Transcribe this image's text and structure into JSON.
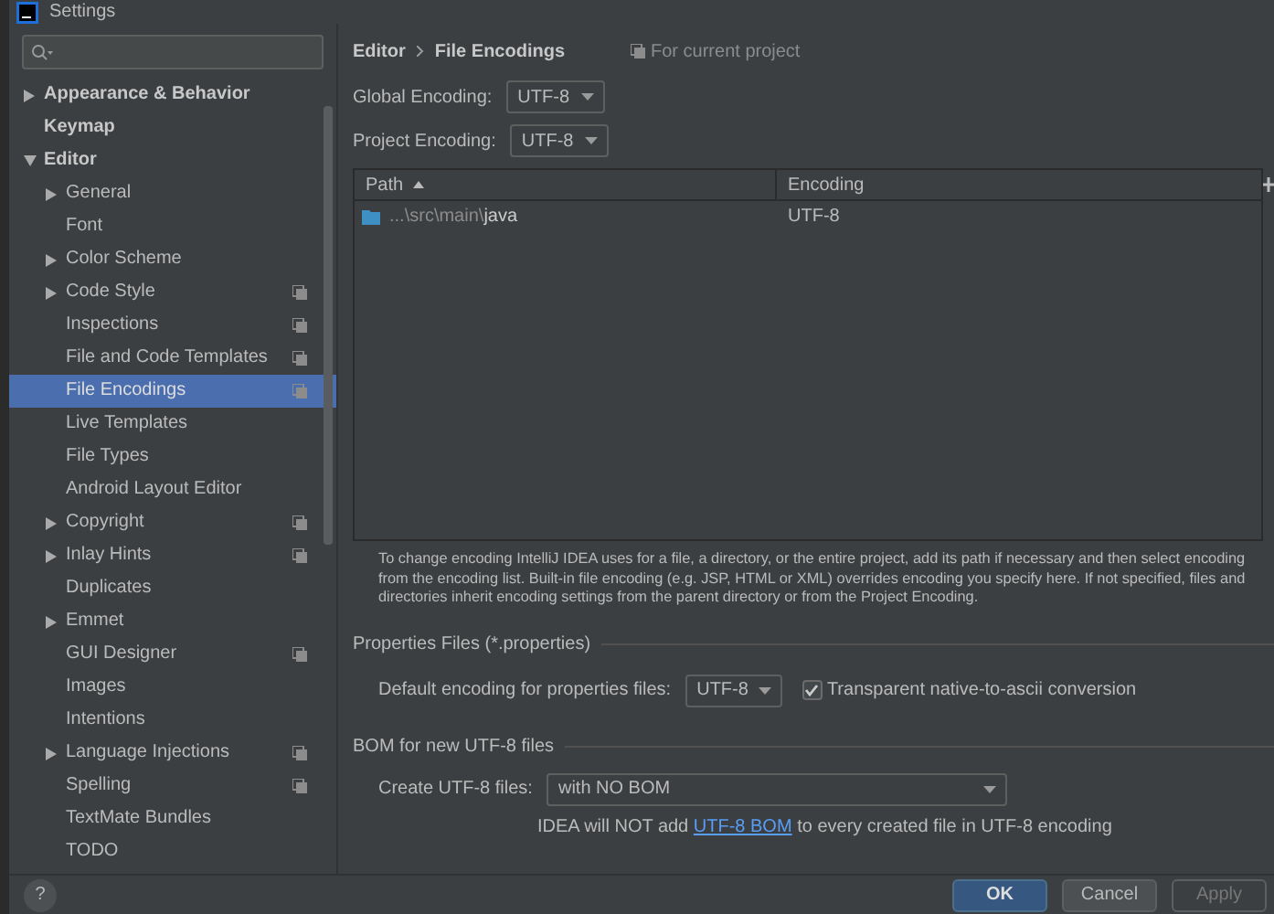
{
  "window": {
    "title": "Settings"
  },
  "sidebar": {
    "items": [
      {
        "label": "Appearance & Behavior",
        "expanded": false,
        "has_children": true,
        "selected": false,
        "project_scoped": false
      },
      {
        "label": "Keymap",
        "has_children": false,
        "selected": false,
        "project_scoped": false
      },
      {
        "label": "Editor",
        "expanded": true,
        "has_children": true,
        "selected": false,
        "project_scoped": false,
        "children": [
          {
            "label": "General",
            "expanded": false,
            "has_children": true,
            "selected": false,
            "project_scoped": false
          },
          {
            "label": "Font",
            "has_children": false,
            "selected": false,
            "project_scoped": false
          },
          {
            "label": "Color Scheme",
            "expanded": false,
            "has_children": true,
            "selected": false,
            "project_scoped": false
          },
          {
            "label": "Code Style",
            "expanded": false,
            "has_children": true,
            "selected": false,
            "project_scoped": true
          },
          {
            "label": "Inspections",
            "has_children": false,
            "selected": false,
            "project_scoped": true
          },
          {
            "label": "File and Code Templates",
            "has_children": false,
            "selected": false,
            "project_scoped": true
          },
          {
            "label": "File Encodings",
            "has_children": false,
            "selected": true,
            "project_scoped": true
          },
          {
            "label": "Live Templates",
            "has_children": false,
            "selected": false,
            "project_scoped": false
          },
          {
            "label": "File Types",
            "has_children": false,
            "selected": false,
            "project_scoped": false
          },
          {
            "label": "Android Layout Editor",
            "has_children": false,
            "selected": false,
            "project_scoped": false
          },
          {
            "label": "Copyright",
            "expanded": false,
            "has_children": true,
            "selected": false,
            "project_scoped": true
          },
          {
            "label": "Inlay Hints",
            "expanded": false,
            "has_children": true,
            "selected": false,
            "project_scoped": true
          },
          {
            "label": "Duplicates",
            "has_children": false,
            "selected": false,
            "project_scoped": false
          },
          {
            "label": "Emmet",
            "expanded": false,
            "has_children": true,
            "selected": false,
            "project_scoped": false
          },
          {
            "label": "GUI Designer",
            "has_children": false,
            "selected": false,
            "project_scoped": true
          },
          {
            "label": "Images",
            "has_children": false,
            "selected": false,
            "project_scoped": false
          },
          {
            "label": "Intentions",
            "has_children": false,
            "selected": false,
            "project_scoped": false
          },
          {
            "label": "Language Injections",
            "expanded": false,
            "has_children": true,
            "selected": false,
            "project_scoped": true
          },
          {
            "label": "Spelling",
            "has_children": false,
            "selected": false,
            "project_scoped": true
          },
          {
            "label": "TextMate Bundles",
            "has_children": false,
            "selected": false,
            "project_scoped": false
          },
          {
            "label": "TODO",
            "has_children": false,
            "selected": false,
            "project_scoped": false
          }
        ]
      }
    ]
  },
  "breadcrumb": [
    "Editor",
    "File Encodings"
  ],
  "scope_note": "For current project",
  "global_encoding": {
    "label": "Global Encoding:",
    "value": "UTF-8"
  },
  "project_encoding": {
    "label": "Project Encoding:",
    "value": "UTF-8"
  },
  "table": {
    "columns": [
      {
        "label": "Path",
        "sorted": true
      },
      {
        "label": "Encoding",
        "sorted": false
      }
    ],
    "rows": [
      {
        "path_prefix": "...\\src\\main\\",
        "path_name": "java",
        "encoding": "UTF-8"
      }
    ]
  },
  "description": "To change encoding IntelliJ IDEA uses for a file, a directory, or the entire project, add its path if necessary and then select encoding from the encoding list. Built-in file encoding (e.g. JSP, HTML or XML) overrides encoding you specify here. If not specified, files and directories inherit encoding settings from the parent directory or from the Project Encoding.",
  "properties_section": {
    "title": "Properties Files (*.properties)",
    "label": "Default encoding for properties files:",
    "value": "UTF-8",
    "checkbox": {
      "label": "Transparent native-to-ascii conversion",
      "checked": true
    }
  },
  "bom_section": {
    "title": "BOM for new UTF-8 files",
    "label": "Create UTF-8 files:",
    "value": "with NO BOM",
    "hint_before": "IDEA will NOT add ",
    "hint_link": "UTF-8 BOM",
    "hint_after": " to every created file in UTF-8 encoding"
  },
  "help_button": "?",
  "buttons": [
    {
      "label": "OK",
      "kind": "primary",
      "disabled": false
    },
    {
      "label": "Cancel",
      "kind": "normal",
      "disabled": false
    },
    {
      "label": "Apply",
      "kind": "normal",
      "disabled": true
    }
  ]
}
